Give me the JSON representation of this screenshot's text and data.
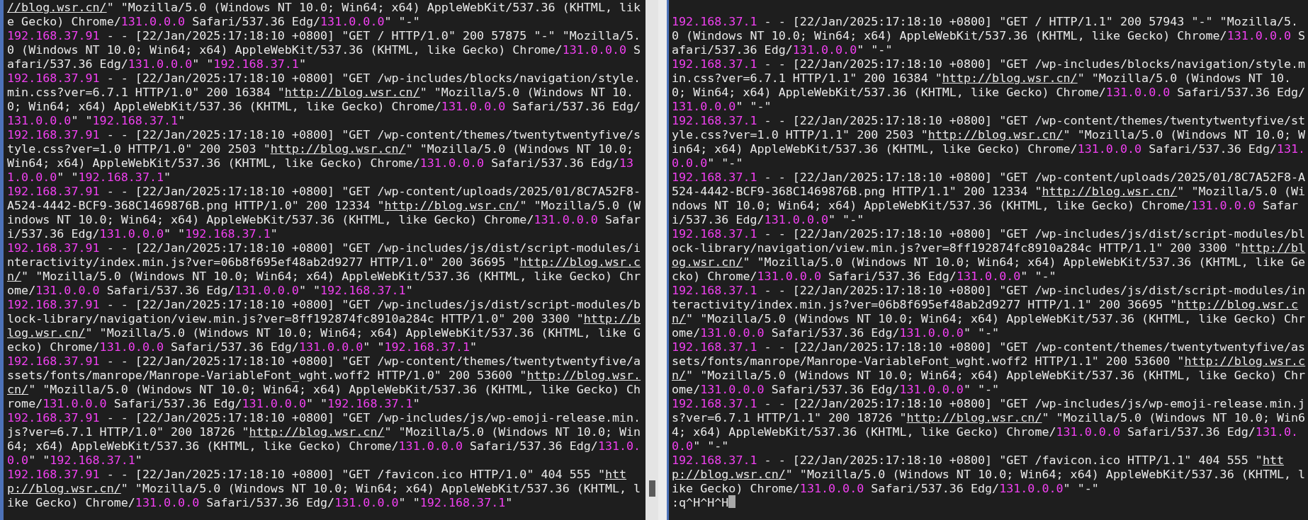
{
  "left_pane": {
    "entries": [
      [
        {
          "kind": "url",
          "text": "//blog.wsr.cn/"
        },
        {
          "kind": "text",
          "text": "\" \"Mozilla/5.0 (Windows NT 10.0; Win64; x64) AppleWebKit/537.36 (KHTML, like Gecko) Chrome/"
        },
        {
          "kind": "version",
          "text": "131.0.0.0"
        },
        {
          "kind": "text",
          "text": " Safari/537.36 Edg/"
        },
        {
          "kind": "version",
          "text": "131.0.0.0"
        },
        {
          "kind": "text",
          "text": "\" \"-\""
        }
      ],
      [
        {
          "kind": "ip",
          "text": "192.168.37.91"
        },
        {
          "kind": "text",
          "text": " - - [22/Jan/2025:17:18:10 +0800] \"GET / HTTP/1.0\" 200 57875 \"-\" \"Mozilla/5.0 (Windows NT 10.0; Win64; x64) AppleWebKit/537.36 (KHTML, like Gecko) Chrome/"
        },
        {
          "kind": "version",
          "text": "131.0.0.0"
        },
        {
          "kind": "text",
          "text": " Safari/537.36 Edg/"
        },
        {
          "kind": "version",
          "text": "131.0.0.0"
        },
        {
          "kind": "text",
          "text": "\" \""
        },
        {
          "kind": "ip",
          "text": "192.168.37.1"
        },
        {
          "kind": "text",
          "text": "\""
        }
      ],
      [
        {
          "kind": "ip",
          "text": "192.168.37.91"
        },
        {
          "kind": "text",
          "text": " - - [22/Jan/2025:17:18:10 +0800] \"GET /wp-includes/blocks/navigation/style.min.css?ver=6.7.1 HTTP/1.0\" 200 16384 \""
        },
        {
          "kind": "url",
          "text": "http://blog.wsr.cn/"
        },
        {
          "kind": "text",
          "text": "\" \"Mozilla/5.0 (Windows NT 10.0; Win64; x64) AppleWebKit/537.36 (KHTML, like Gecko) Chrome/"
        },
        {
          "kind": "version",
          "text": "131.0.0.0"
        },
        {
          "kind": "text",
          "text": " Safari/537.36 Edg/"
        },
        {
          "kind": "version",
          "text": "131.0.0.0"
        },
        {
          "kind": "text",
          "text": "\" \""
        },
        {
          "kind": "ip",
          "text": "192.168.37.1"
        },
        {
          "kind": "text",
          "text": "\""
        }
      ],
      [
        {
          "kind": "ip",
          "text": "192.168.37.91"
        },
        {
          "kind": "text",
          "text": " - - [22/Jan/2025:17:18:10 +0800] \"GET /wp-content/themes/twentytwentyfive/style.css?ver=1.0 HTTP/1.0\" 200 2503 \""
        },
        {
          "kind": "url",
          "text": "http://blog.wsr.cn/"
        },
        {
          "kind": "text",
          "text": "\" \"Mozilla/5.0 (Windows NT 10.0; Win64; x64) AppleWebKit/537.36 (KHTML, like Gecko) Chrome/"
        },
        {
          "kind": "version",
          "text": "131.0.0.0"
        },
        {
          "kind": "text",
          "text": " Safari/537.36 Edg/"
        },
        {
          "kind": "version",
          "text": "131.0.0.0"
        },
        {
          "kind": "text",
          "text": "\" \""
        },
        {
          "kind": "ip",
          "text": "192.168.37.1"
        },
        {
          "kind": "text",
          "text": "\""
        }
      ],
      [
        {
          "kind": "ip",
          "text": "192.168.37.91"
        },
        {
          "kind": "text",
          "text": " - - [22/Jan/2025:17:18:10 +0800] \"GET /wp-content/uploads/2025/01/8C7A52F8-A524-4442-BCF9-368C1469876B.png HTTP/1.0\" 200 12334 \""
        },
        {
          "kind": "url",
          "text": "http://blog.wsr.cn/"
        },
        {
          "kind": "text",
          "text": "\" \"Mozilla/5.0 (Windows NT 10.0; Win64; x64) AppleWebKit/537.36 (KHTML, like Gecko) Chrome/"
        },
        {
          "kind": "version",
          "text": "131.0.0.0"
        },
        {
          "kind": "text",
          "text": " Safari/537.36 Edg/"
        },
        {
          "kind": "version",
          "text": "131.0.0.0"
        },
        {
          "kind": "text",
          "text": "\" \""
        },
        {
          "kind": "ip",
          "text": "192.168.37.1"
        },
        {
          "kind": "text",
          "text": "\""
        }
      ],
      [
        {
          "kind": "ip",
          "text": "192.168.37.91"
        },
        {
          "kind": "text",
          "text": " - - [22/Jan/2025:17:18:10 +0800] \"GET /wp-includes/js/dist/script-modules/interactivity/index.min.js?ver=06b8f695ef48ab2d9277 HTTP/1.0\" 200 36695 \""
        },
        {
          "kind": "url",
          "text": "http://blog.wsr.cn/"
        },
        {
          "kind": "text",
          "text": "\" \"Mozilla/5.0 (Windows NT 10.0; Win64; x64) AppleWebKit/537.36 (KHTML, like Gecko) Chrome/"
        },
        {
          "kind": "version",
          "text": "131.0.0.0"
        },
        {
          "kind": "text",
          "text": " Safari/537.36 Edg/"
        },
        {
          "kind": "version",
          "text": "131.0.0.0"
        },
        {
          "kind": "text",
          "text": "\" \""
        },
        {
          "kind": "ip",
          "text": "192.168.37.1"
        },
        {
          "kind": "text",
          "text": "\""
        }
      ],
      [
        {
          "kind": "ip",
          "text": "192.168.37.91"
        },
        {
          "kind": "text",
          "text": " - - [22/Jan/2025:17:18:10 +0800] \"GET /wp-includes/js/dist/script-modules/block-library/navigation/view.min.js?ver=8ff192874fc8910a284c HTTP/1.0\" 200 3300 \""
        },
        {
          "kind": "url",
          "text": "http://blog.wsr.cn/"
        },
        {
          "kind": "text",
          "text": "\" \"Mozilla/5.0 (Windows NT 10.0; Win64; x64) AppleWebKit/537.36 (KHTML, like Gecko) Chrome/"
        },
        {
          "kind": "version",
          "text": "131.0.0.0"
        },
        {
          "kind": "text",
          "text": " Safari/537.36 Edg/"
        },
        {
          "kind": "version",
          "text": "131.0.0.0"
        },
        {
          "kind": "text",
          "text": "\" \""
        },
        {
          "kind": "ip",
          "text": "192.168.37.1"
        },
        {
          "kind": "text",
          "text": "\""
        }
      ],
      [
        {
          "kind": "ip",
          "text": "192.168.37.91"
        },
        {
          "kind": "text",
          "text": " - - [22/Jan/2025:17:18:10 +0800] \"GET /wp-content/themes/twentytwentyfive/assets/fonts/manrope/Manrope-VariableFont_wght.woff2 HTTP/1.0\" 200 53600 \""
        },
        {
          "kind": "url",
          "text": "http://blog.wsr.cn/"
        },
        {
          "kind": "text",
          "text": "\" \"Mozilla/5.0 (Windows NT 10.0; Win64; x64) AppleWebKit/537.36 (KHTML, like Gecko) Chrome/"
        },
        {
          "kind": "version",
          "text": "131.0.0.0"
        },
        {
          "kind": "text",
          "text": " Safari/537.36 Edg/"
        },
        {
          "kind": "version",
          "text": "131.0.0.0"
        },
        {
          "kind": "text",
          "text": "\" \""
        },
        {
          "kind": "ip",
          "text": "192.168.37.1"
        },
        {
          "kind": "text",
          "text": "\""
        }
      ],
      [
        {
          "kind": "ip",
          "text": "192.168.37.91"
        },
        {
          "kind": "text",
          "text": " - - [22/Jan/2025:17:18:10 +0800] \"GET /wp-includes/js/wp-emoji-release.min.js?ver=6.7.1 HTTP/1.0\" 200 18726 \""
        },
        {
          "kind": "url",
          "text": "http://blog.wsr.cn/"
        },
        {
          "kind": "text",
          "text": "\" \"Mozilla/5.0 (Windows NT 10.0; Win64; x64) AppleWebKit/537.36 (KHTML, like Gecko) Chrome/"
        },
        {
          "kind": "version",
          "text": "131.0.0.0"
        },
        {
          "kind": "text",
          "text": " Safari/537.36 Edg/"
        },
        {
          "kind": "version",
          "text": "131.0.0.0"
        },
        {
          "kind": "text",
          "text": "\" \""
        },
        {
          "kind": "ip",
          "text": "192.168.37.1"
        },
        {
          "kind": "text",
          "text": "\""
        }
      ],
      [
        {
          "kind": "ip",
          "text": "192.168.37.91"
        },
        {
          "kind": "text",
          "text": " - - [22/Jan/2025:17:18:10 +0800] \"GET /favicon.ico HTTP/1.0\" 404 555 \""
        },
        {
          "kind": "url",
          "text": "http://blog.wsr.cn/"
        },
        {
          "kind": "text",
          "text": "\" \"Mozilla/5.0 (Windows NT 10.0; Win64; x64) AppleWebKit/537.36 (KHTML, like Gecko) Chrome/"
        },
        {
          "kind": "version",
          "text": "131.0.0.0"
        },
        {
          "kind": "text",
          "text": " Safari/537.36 Edg/"
        },
        {
          "kind": "version",
          "text": "131.0.0.0"
        },
        {
          "kind": "text",
          "text": "\" \""
        },
        {
          "kind": "ip",
          "text": "192.168.37.1"
        },
        {
          "kind": "text",
          "text": "\""
        }
      ]
    ]
  },
  "right_pane": {
    "entries": [
      [
        {
          "kind": "ip",
          "text": "192.168.37.1"
        },
        {
          "kind": "text",
          "text": " - - [22/Jan/2025:17:18:10 +0800] \"GET / HTTP/1.1\" 200 57943 \"-\" \"Mozilla/5.0 (Windows NT 10.0; Win64; x64) AppleWebKit/537.36 (KHTML, like Gecko) Chrome/"
        },
        {
          "kind": "version",
          "text": "131.0.0.0"
        },
        {
          "kind": "text",
          "text": " Safari/537.36 Edg/"
        },
        {
          "kind": "version",
          "text": "131.0.0.0"
        },
        {
          "kind": "text",
          "text": "\" \"-\""
        }
      ],
      [
        {
          "kind": "ip",
          "text": "192.168.37.1"
        },
        {
          "kind": "text",
          "text": " - - [22/Jan/2025:17:18:10 +0800] \"GET /wp-includes/blocks/navigation/style.min.css?ver=6.7.1 HTTP/1.1\" 200 16384 \""
        },
        {
          "kind": "url",
          "text": "http://blog.wsr.cn/"
        },
        {
          "kind": "text",
          "text": "\" \"Mozilla/5.0 (Windows NT 10.0; Win64; x64) AppleWebKit/537.36 (KHTML, like Gecko) Chrome/"
        },
        {
          "kind": "version",
          "text": "131.0.0.0"
        },
        {
          "kind": "text",
          "text": " Safari/537.36 Edg/"
        },
        {
          "kind": "version",
          "text": "131.0.0.0"
        },
        {
          "kind": "text",
          "text": "\" \"-\""
        }
      ],
      [
        {
          "kind": "ip",
          "text": "192.168.37.1"
        },
        {
          "kind": "text",
          "text": " - - [22/Jan/2025:17:18:10 +0800] \"GET /wp-content/themes/twentytwentyfive/style.css?ver=1.0 HTTP/1.1\" 200 2503 \""
        },
        {
          "kind": "url",
          "text": "http://blog.wsr.cn/"
        },
        {
          "kind": "text",
          "text": "\" \"Mozilla/5.0 (Windows NT 10.0; Win64; x64) AppleWebKit/537.36 (KHTML, like Gecko) Chrome/"
        },
        {
          "kind": "version",
          "text": "131.0.0.0"
        },
        {
          "kind": "text",
          "text": " Safari/537.36 Edg/"
        },
        {
          "kind": "version",
          "text": "131.0.0.0"
        },
        {
          "kind": "text",
          "text": "\" \"-\""
        }
      ],
      [
        {
          "kind": "ip",
          "text": "192.168.37.1"
        },
        {
          "kind": "text",
          "text": " - - [22/Jan/2025:17:18:10 +0800] \"GET /wp-content/uploads/2025/01/8C7A52F8-A524-4442-BCF9-368C1469876B.png HTTP/1.1\" 200 12334 \""
        },
        {
          "kind": "url",
          "text": "http://blog.wsr.cn/"
        },
        {
          "kind": "text",
          "text": "\" \"Mozilla/5.0 (Windows NT 10.0; Win64; x64) AppleWebKit/537.36 (KHTML, like Gecko) Chrome/"
        },
        {
          "kind": "version",
          "text": "131.0.0.0"
        },
        {
          "kind": "text",
          "text": " Safari/537.36 Edg/"
        },
        {
          "kind": "version",
          "text": "131.0.0.0"
        },
        {
          "kind": "text",
          "text": "\" \"-\""
        }
      ],
      [
        {
          "kind": "ip",
          "text": "192.168.37.1"
        },
        {
          "kind": "text",
          "text": " - - [22/Jan/2025:17:18:10 +0800] \"GET /wp-includes/js/dist/script-modules/block-library/navigation/view.min.js?ver=8ff192874fc8910a284c HTTP/1.1\" 200 3300 \""
        },
        {
          "kind": "url",
          "text": "http://blog.wsr.cn/"
        },
        {
          "kind": "text",
          "text": "\" \"Mozilla/5.0 (Windows NT 10.0; Win64; x64) AppleWebKit/537.36 (KHTML, like Gecko) Chrome/"
        },
        {
          "kind": "version",
          "text": "131.0.0.0"
        },
        {
          "kind": "text",
          "text": " Safari/537.36 Edg/"
        },
        {
          "kind": "version",
          "text": "131.0.0.0"
        },
        {
          "kind": "text",
          "text": "\" \"-\""
        }
      ],
      [
        {
          "kind": "ip",
          "text": "192.168.37.1"
        },
        {
          "kind": "text",
          "text": " - - [22/Jan/2025:17:18:10 +0800] \"GET /wp-includes/js/dist/script-modules/interactivity/index.min.js?ver=06b8f695ef48ab2d9277 HTTP/1.1\" 200 36695 \""
        },
        {
          "kind": "url",
          "text": "http://blog.wsr.cn/"
        },
        {
          "kind": "text",
          "text": "\" \"Mozilla/5.0 (Windows NT 10.0; Win64; x64) AppleWebKit/537.36 (KHTML, like Gecko) Chrome/"
        },
        {
          "kind": "version",
          "text": "131.0.0.0"
        },
        {
          "kind": "text",
          "text": " Safari/537.36 Edg/"
        },
        {
          "kind": "version",
          "text": "131.0.0.0"
        },
        {
          "kind": "text",
          "text": "\" \"-\""
        }
      ],
      [
        {
          "kind": "ip",
          "text": "192.168.37.1"
        },
        {
          "kind": "text",
          "text": " - - [22/Jan/2025:17:18:10 +0800] \"GET /wp-content/themes/twentytwentyfive/assets/fonts/manrope/Manrope-VariableFont_wght.woff2 HTTP/1.1\" 200 53600 \""
        },
        {
          "kind": "url",
          "text": "http://blog.wsr.cn/"
        },
        {
          "kind": "text",
          "text": "\" \"Mozilla/5.0 (Windows NT 10.0; Win64; x64) AppleWebKit/537.36 (KHTML, like Gecko) Chrome/"
        },
        {
          "kind": "version",
          "text": "131.0.0.0"
        },
        {
          "kind": "text",
          "text": " Safari/537.36 Edg/"
        },
        {
          "kind": "version",
          "text": "131.0.0.0"
        },
        {
          "kind": "text",
          "text": "\" \"-\""
        }
      ],
      [
        {
          "kind": "ip",
          "text": "192.168.37.1"
        },
        {
          "kind": "text",
          "text": " - - [22/Jan/2025:17:18:10 +0800] \"GET /wp-includes/js/wp-emoji-release.min.js?ver=6.7.1 HTTP/1.1\" 200 18726 \""
        },
        {
          "kind": "url",
          "text": "http://blog.wsr.cn/"
        },
        {
          "kind": "text",
          "text": "\" \"Mozilla/5.0 (Windows NT 10.0; Win64; x64) AppleWebKit/537.36 (KHTML, like Gecko) Chrome/"
        },
        {
          "kind": "version",
          "text": "131.0.0.0"
        },
        {
          "kind": "text",
          "text": " Safari/537.36 Edg/"
        },
        {
          "kind": "version",
          "text": "131.0.0.0"
        },
        {
          "kind": "text",
          "text": "\" \"-\""
        }
      ],
      [
        {
          "kind": "ip",
          "text": "192.168.37.1"
        },
        {
          "kind": "text",
          "text": " - - [22/Jan/2025:17:18:10 +0800] \"GET /favicon.ico HTTP/1.1\" 404 555 \""
        },
        {
          "kind": "url",
          "text": "http://blog.wsr.cn/"
        },
        {
          "kind": "text",
          "text": "\" \"Mozilla/5.0 (Windows NT 10.0; Win64; x64) AppleWebKit/537.36 (KHTML, like Gecko) Chrome/"
        },
        {
          "kind": "version",
          "text": "131.0.0.0"
        },
        {
          "kind": "text",
          "text": " Safari/537.36 Edg/"
        },
        {
          "kind": "version",
          "text": "131.0.0.0"
        },
        {
          "kind": "text",
          "text": "\" \"-\""
        }
      ]
    ],
    "prompt": ":q^H^H^H"
  }
}
